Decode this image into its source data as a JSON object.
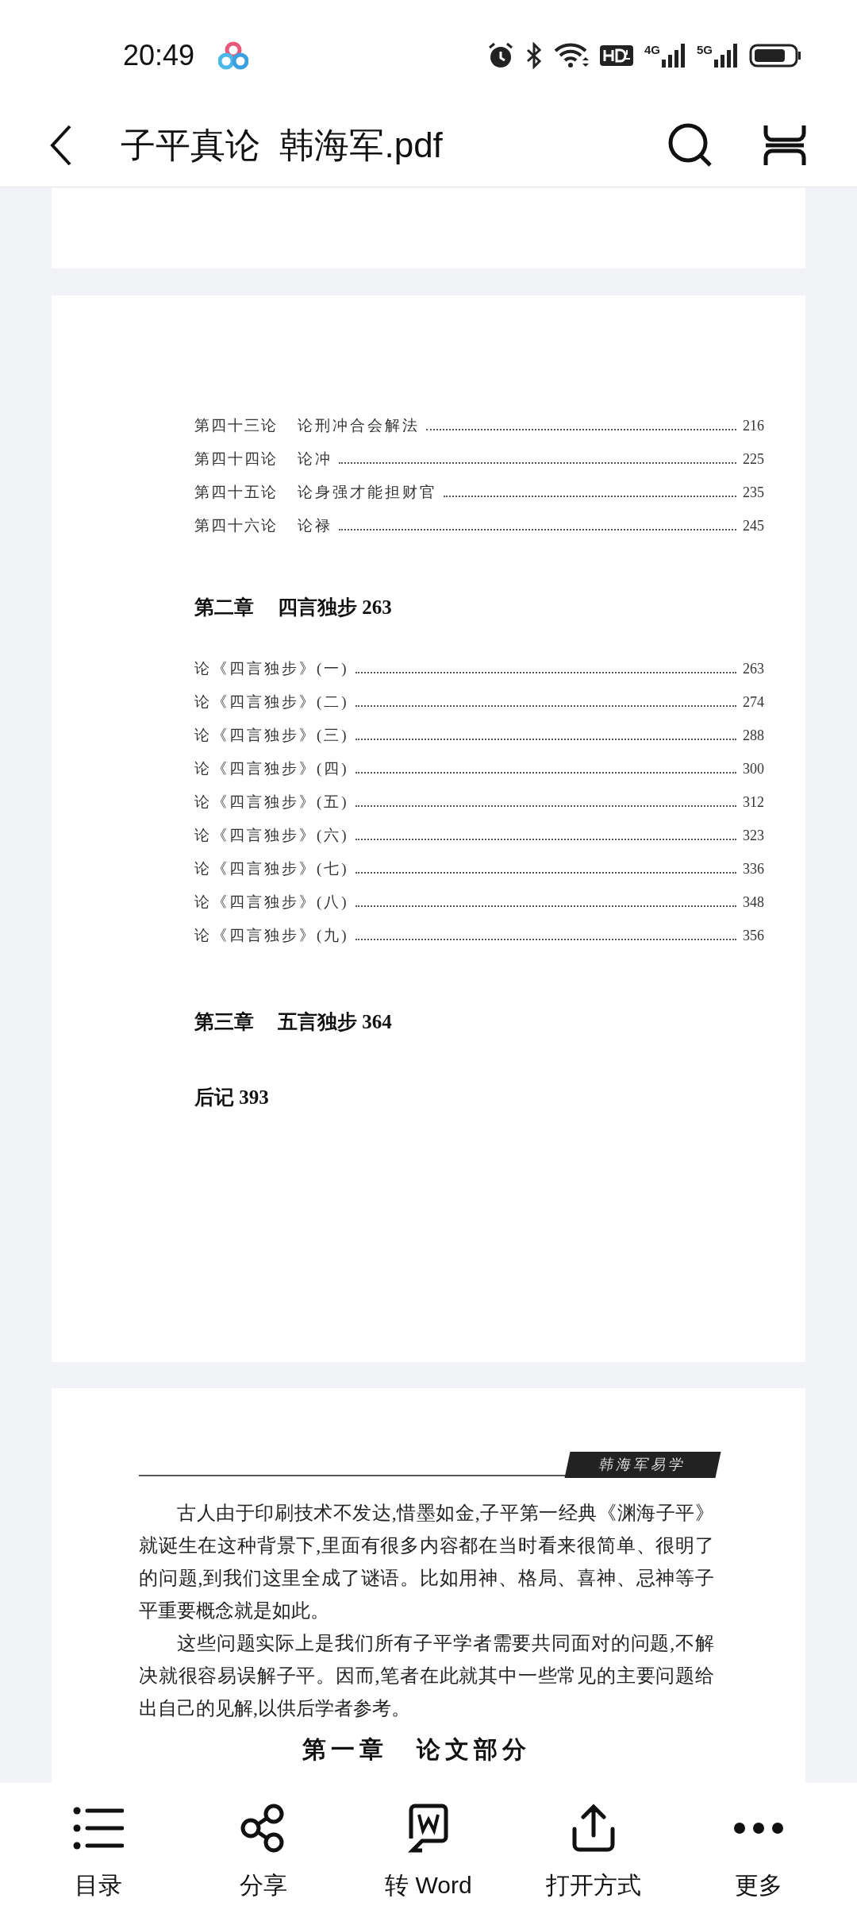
{
  "status_bar": {
    "time": "20:49",
    "network_labels": [
      "4G",
      "5G"
    ]
  },
  "app_bar": {
    "title": "子平真论  韩海军.pdf"
  },
  "toc_page": {
    "entries": [
      {
        "kind": "entry",
        "number": "第四十三论",
        "title": "论刑冲合会解法",
        "page": "216"
      },
      {
        "kind": "entry",
        "number": "第四十四论",
        "title": "论冲",
        "page": "225"
      },
      {
        "kind": "entry",
        "number": "第四十五论",
        "title": "论身强才能担财官",
        "page": "235"
      },
      {
        "kind": "entry",
        "number": "第四十六论",
        "title": "论禄",
        "page": "245"
      },
      {
        "kind": "chapter",
        "number": "第二章",
        "title": "四言独步 263"
      },
      {
        "kind": "entry",
        "title": "论《四言独步》(一)",
        "page": "263"
      },
      {
        "kind": "entry",
        "title": "论《四言独步》(二)",
        "page": "274"
      },
      {
        "kind": "entry",
        "title": "论《四言独步》(三)",
        "page": "288"
      },
      {
        "kind": "entry",
        "title": "论《四言独步》(四)",
        "page": "300"
      },
      {
        "kind": "entry",
        "title": "论《四言独步》(五)",
        "page": "312"
      },
      {
        "kind": "entry",
        "title": "论《四言独步》(六)",
        "page": "323"
      },
      {
        "kind": "entry",
        "title": "论《四言独步》(七)",
        "page": "336"
      },
      {
        "kind": "entry",
        "title": "论《四言独步》(八)",
        "page": "348"
      },
      {
        "kind": "entry",
        "title": "论《四言独步》(九)",
        "page": "356"
      },
      {
        "kind": "chapter",
        "number": "第三章",
        "title": "五言独步 364"
      },
      {
        "kind": "chapter",
        "title": "后记 393"
      }
    ]
  },
  "text_page": {
    "running_header": "韩海军易学",
    "paragraphs": [
      "古人由于印刷技术不发达,惜墨如金,子平第一经典《渊海子平》就诞生在这种背景下,里面有很多内容都在当时看来很简单、很明了的问题,到我们这里全成了谜语。比如用神、格局、喜神、忌神等子平重要概念就是如此。",
      "这些问题实际上是我们所有子平学者需要共同面对的问题,不解决就很容易误解子平。因而,笔者在此就其中一些常见的主要问题给出自己的见解,以供后学者参考。"
    ],
    "heading": "第一章　论文部分"
  },
  "bottom_nav": [
    {
      "kind": "list",
      "label": "目录"
    },
    {
      "kind": "share",
      "label": "分享"
    },
    {
      "kind": "word",
      "label": "转 Word"
    },
    {
      "kind": "open",
      "label": "打开方式"
    },
    {
      "kind": "more",
      "label": "更多"
    }
  ]
}
